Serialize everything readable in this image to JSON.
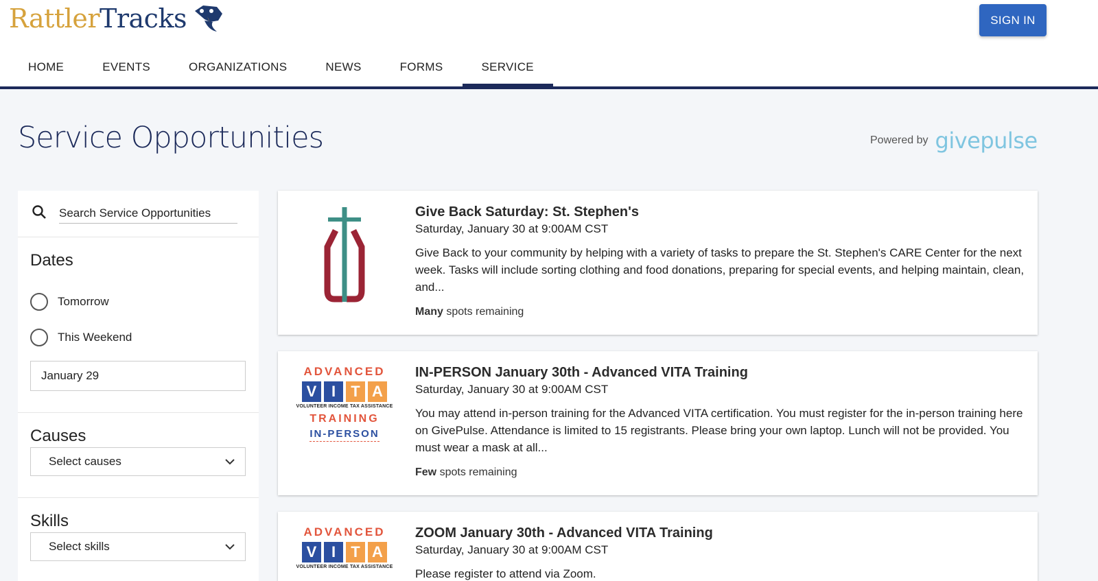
{
  "header": {
    "logo_part1": "Rattler",
    "logo_part2": "Tracks",
    "sign_in": "SIGN IN",
    "nav": [
      "HOME",
      "EVENTS",
      "ORGANIZATIONS",
      "NEWS",
      "FORMS",
      "SERVICE"
    ],
    "active_nav": "SERVICE"
  },
  "page": {
    "title": "Service Opportunities",
    "powered_by": "Powered by",
    "provider": "givepulse"
  },
  "sidebar": {
    "search_placeholder": "Search Service Opportunities",
    "dates_title": "Dates",
    "date_options": [
      "Tomorrow",
      "This Weekend"
    ],
    "date_value": "January 29",
    "causes_title": "Causes",
    "causes_select": "Select causes",
    "skills_title": "Skills",
    "skills_select": "Select skills"
  },
  "cards": [
    {
      "title": "Give Back Saturday: St. Stephen's",
      "date": "Saturday, January 30 at 9:00AM CST",
      "description": "Give Back to your community by helping with a variety of tasks to prepare the St. Stephen's CARE Center for the next week. Tasks will include sorting clothing and food donations, preparing for special events, and helping maintain, clean, and...",
      "spots_strong": "Many",
      "spots_rest": " spots remaining"
    },
    {
      "title": "IN-PERSON January 30th - Advanced VITA Training",
      "date": "Saturday, January 30 at 9:00AM CST",
      "description": "You may attend in-person training for the Advanced VITA certification.  You must register for the in-person training here on GivePulse. Attendance is limited to 15 registrants.  Please bring your own laptop. Lunch will not be provided. You must wear a mask at all...",
      "spots_strong": "Few",
      "spots_rest": " spots remaining"
    },
    {
      "title": "ZOOM January 30th - Advanced VITA Training",
      "date": "Saturday, January 30 at 9:00AM CST",
      "description": "Please register to attend via Zoom."
    }
  ],
  "vita_logo": {
    "advanced": "ADVANCED",
    "letters": [
      "V",
      "I",
      "T",
      "A"
    ],
    "subtitle": "VOLUNTEER INCOME TAX ASSISTANCE",
    "training": "TRAINING",
    "in_person": "IN-PERSON"
  },
  "colors": {
    "navy": "#1c2a5a",
    "signin_blue": "#2f66c0",
    "logo_gold": "#d6a23c",
    "givepulse_blue": "#7fc5e0"
  }
}
